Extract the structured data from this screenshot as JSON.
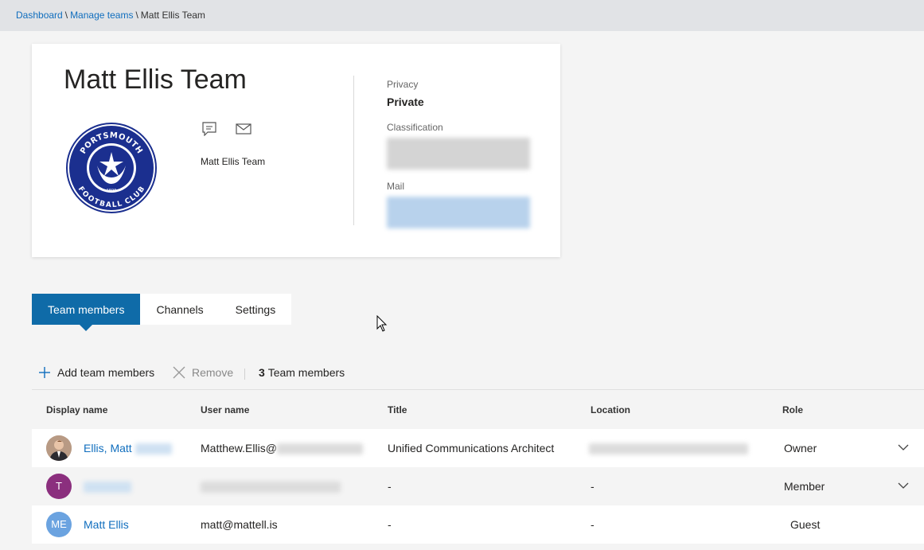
{
  "breadcrumb": {
    "dashboard": "Dashboard",
    "sep1": "\\",
    "manage_teams": "Manage teams",
    "sep2": "\\",
    "current": "Matt Ellis Team"
  },
  "team": {
    "name": "Matt Ellis Team",
    "logo_alt": "Portsmouth Football Club crest",
    "logo_text_top": "PORTSMOUTH",
    "logo_text_bottom": "FOOTBALL CLUB",
    "logo_year": "1898",
    "subtitle": "Matt Ellis Team",
    "icons": [
      "conversation-icon",
      "mail-icon"
    ]
  },
  "details": {
    "privacy_label": "Privacy",
    "privacy_value": "Private",
    "classification_label": "Classification",
    "mail_label": "Mail"
  },
  "tabs": [
    {
      "label": "Team members",
      "active": true
    },
    {
      "label": "Channels",
      "active": false
    },
    {
      "label": "Settings",
      "active": false
    }
  ],
  "toolbar": {
    "add_label": "Add team members",
    "remove_label": "Remove",
    "count": "3",
    "count_label": "Team members"
  },
  "table": {
    "headers": [
      "Display name",
      "User name",
      "Title",
      "Location",
      "Role"
    ],
    "rows": [
      {
        "initials": "",
        "display_name": "Ellis, Matt",
        "user_name": "Matthew.Ellis@",
        "title": "Unified Communications Architect",
        "location": "",
        "role": "Owner",
        "avatar_color": "#a07050",
        "has_chevron": true
      },
      {
        "initials": "T",
        "display_name": "",
        "user_name": "",
        "title": "-",
        "location": "-",
        "role": "Member",
        "avatar_color": "#8b2f7e",
        "has_chevron": true
      },
      {
        "initials": "ME",
        "display_name": "Matt Ellis",
        "user_name": "matt@mattell.is",
        "title": "-",
        "location": "-",
        "role": "Guest",
        "avatar_color": "#6ba3e0",
        "has_chevron": false
      }
    ]
  },
  "colors": {
    "accent": "#0f6ba8",
    "link": "#106ebe",
    "logo_navy": "#1b2f8f"
  }
}
